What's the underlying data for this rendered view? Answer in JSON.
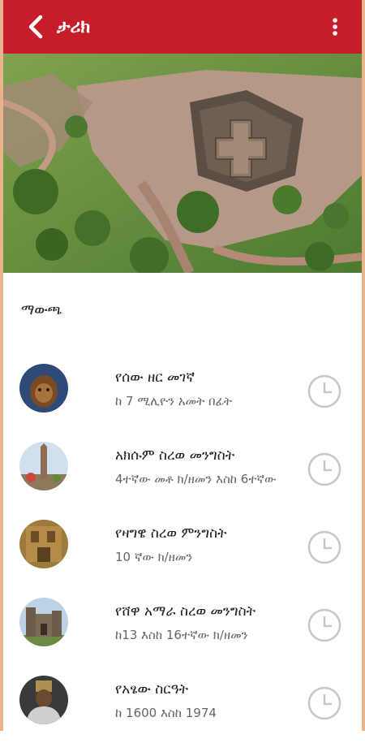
{
  "appbar": {
    "title": "ታሪክ",
    "back_icon": "chevron-left-icon",
    "menu_icon": "more-vert-icon",
    "color": "#c61d2a"
  },
  "section_label": "ማውጫ",
  "items": [
    {
      "title": "የሰው ዘር መገኛ",
      "subtitle": "ከ 7 ሚሊዮን አመት በፊት",
      "thumb": "early-human",
      "icon": "clock-icon"
    },
    {
      "title": "አክሱም ስረወ መንግስት",
      "subtitle": "4ተኛው መቶ ክ/ዘመን እስከ 6ተኛው",
      "thumb": "axum-obelisk",
      "icon": "clock-icon"
    },
    {
      "title": "የዛግዌ ስረወ ምንግስት",
      "subtitle": "10 ኛው ክ/ዘመን",
      "thumb": "lalibela-church",
      "icon": "clock-icon"
    },
    {
      "title": "የሸዋ አማራ ስረወ መንግስት",
      "subtitle": "ከ13 እስከ 16ተኛው ክ/ዘመን",
      "thumb": "gondar-castle",
      "icon": "clock-icon"
    },
    {
      "title": "የአፄው ስርዓት",
      "subtitle": "ከ 1600 እስከ 1974",
      "thumb": "emperor-portrait",
      "icon": "clock-icon"
    }
  ]
}
